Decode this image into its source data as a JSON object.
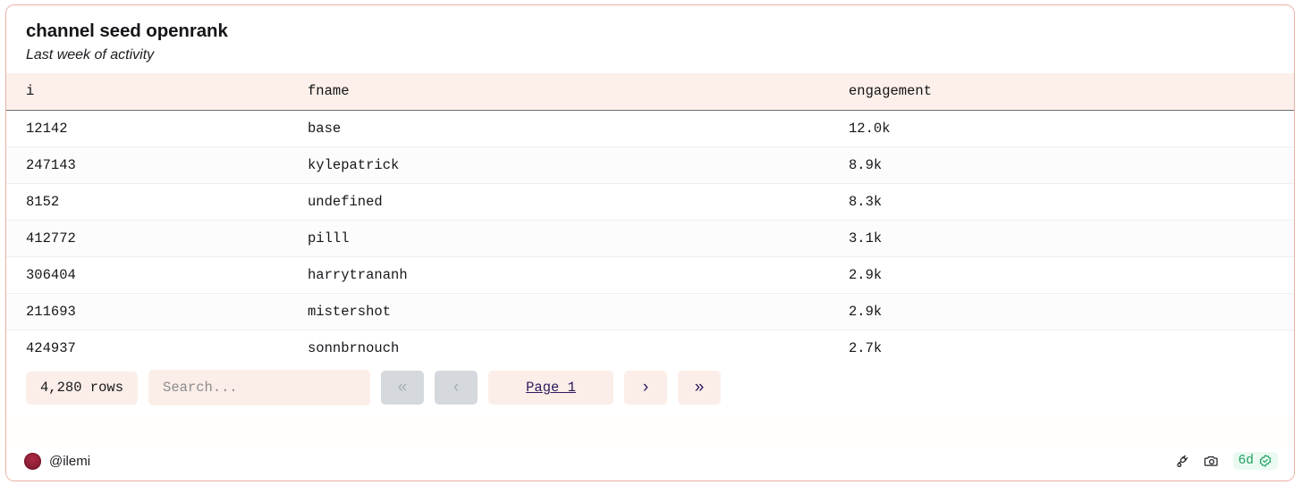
{
  "card": {
    "title": "channel seed openrank",
    "subtitle": "Last week of activity",
    "border_color": "#e9b1a3",
    "accent_bg": "#fbeee8",
    "header_bg": "#fdf0ea",
    "link_color": "#2b1b5e"
  },
  "table": {
    "columns": [
      {
        "key": "i",
        "label": "i"
      },
      {
        "key": "fname",
        "label": "fname"
      },
      {
        "key": "engagement",
        "label": "engagement"
      }
    ],
    "rows": [
      {
        "i": "12142",
        "fname": "base",
        "engagement": "12.0k"
      },
      {
        "i": "247143",
        "fname": "kylepatrick",
        "engagement": "8.9k"
      },
      {
        "i": "8152",
        "fname": "undefined",
        "engagement": "8.3k"
      },
      {
        "i": "412772",
        "fname": "pilll",
        "engagement": "3.1k"
      },
      {
        "i": "306404",
        "fname": "harrytrananh",
        "engagement": "2.9k"
      },
      {
        "i": "211693",
        "fname": "mistershot",
        "engagement": "2.9k"
      },
      {
        "i": "424937",
        "fname": "sonnbrnouch",
        "engagement": "2.7k"
      }
    ]
  },
  "toolbar": {
    "row_count": "4,280 rows",
    "search_value": "",
    "search_placeholder": "Search...",
    "first_page_label": "«",
    "prev_page_label": "‹",
    "page_label": "Page 1",
    "next_page_label": "›",
    "last_page_label": "»",
    "first_page_disabled": "true",
    "prev_page_disabled": "true"
  },
  "footer": {
    "author": "@ilemi",
    "plug_icon": "plug-icon",
    "camera_icon": "camera-icon",
    "freshness": "6d",
    "verified_icon": "verified-check-icon",
    "freshness_color": "#1f9e5f"
  }
}
